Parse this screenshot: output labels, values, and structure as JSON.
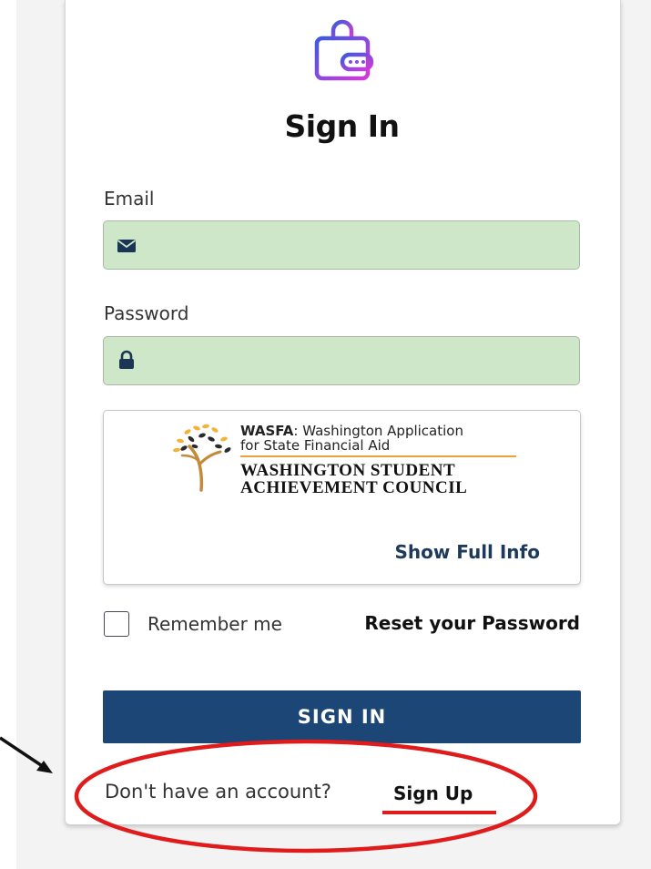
{
  "login": {
    "title": "Sign In",
    "email_label": "Email",
    "password_label": "Password",
    "remember_label": "Remember me",
    "reset_label": "Reset your Password",
    "signin_button": "SIGN IN",
    "no_account_text": "Don't have an account?",
    "signup_label": "Sign Up"
  },
  "info_card": {
    "wasfa_bold": "WASFA",
    "wasfa_rest": ": Washington Application",
    "wasfa_line2": "for State Financial Aid",
    "wsac_line1": "WASHINGTON STUDENT",
    "wsac_line2": "ACHIEVEMENT COUNCIL",
    "show_full_info": "Show Full Info"
  },
  "icons": {
    "app_logo": "wallet-lock-icon",
    "email": "envelope-icon",
    "password": "lock-icon",
    "wasfa": "tree-icon"
  },
  "colors": {
    "primary_button": "#1b4676",
    "input_fill": "#cde7c8",
    "annotation": "#e01b1b",
    "logo_gradient_start": "#3b5bdb",
    "logo_gradient_end": "#d63ad6"
  }
}
